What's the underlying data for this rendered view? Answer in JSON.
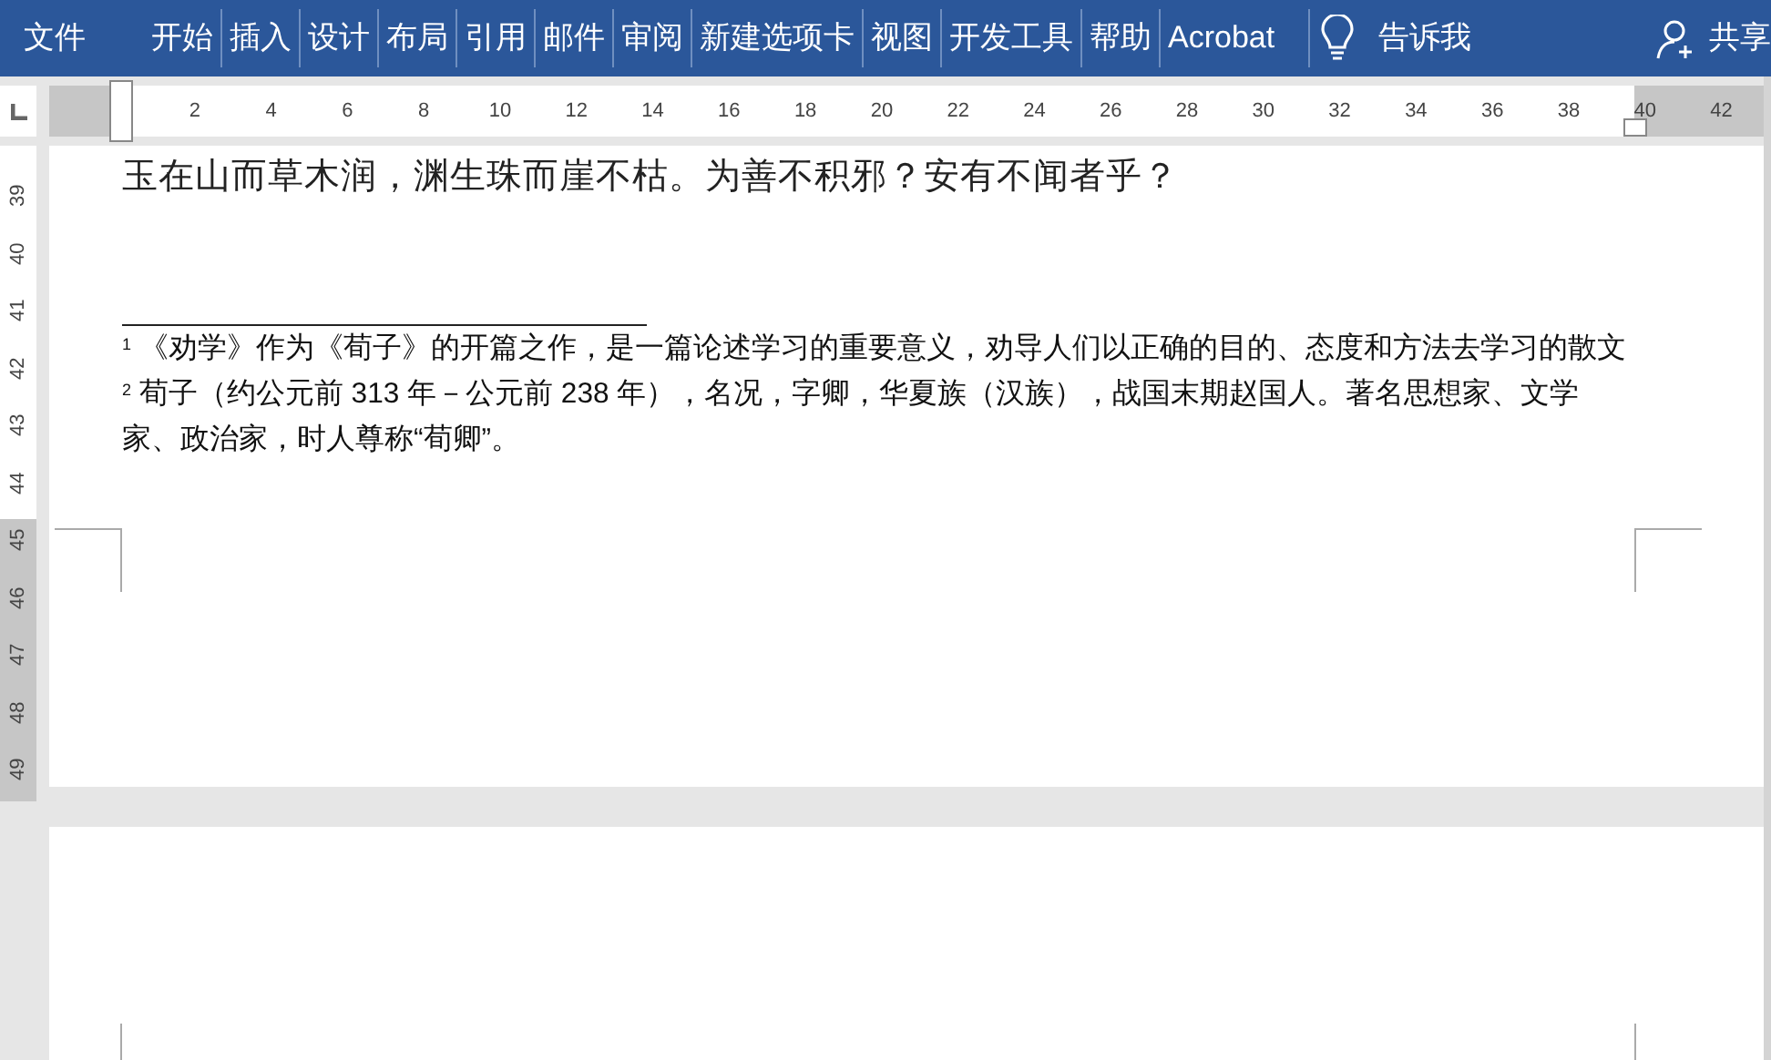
{
  "ribbon": {
    "tabs": [
      {
        "label": "文件",
        "kind": "file"
      },
      {
        "label": "开始",
        "kind": "tab"
      },
      {
        "label": "插入",
        "kind": "tab"
      },
      {
        "label": "设计",
        "kind": "tab"
      },
      {
        "label": "布局",
        "kind": "tab"
      },
      {
        "label": "引用",
        "kind": "tab"
      },
      {
        "label": "邮件",
        "kind": "tab"
      },
      {
        "label": "审阅",
        "kind": "tab"
      },
      {
        "label": "新建选项卡",
        "kind": "tab"
      },
      {
        "label": "视图",
        "kind": "tab"
      },
      {
        "label": "开发工具",
        "kind": "tab"
      },
      {
        "label": "帮助",
        "kind": "tab"
      },
      {
        "label": "Acrobat",
        "kind": "tab"
      }
    ],
    "tell_me": "告诉我",
    "share": "共享"
  },
  "horizontal_ruler": [
    "2",
    "4",
    "6",
    "8",
    "10",
    "12",
    "14",
    "16",
    "18",
    "20",
    "22",
    "24",
    "26",
    "28",
    "30",
    "32",
    "34",
    "36",
    "38",
    "40",
    "42"
  ],
  "vertical_ruler": [
    "39",
    "40",
    "41",
    "42",
    "43",
    "44",
    "45",
    "46",
    "47",
    "48",
    "49"
  ],
  "document": {
    "body": "玉在山而草木润，渊生珠而崖不枯。为善不积邪？安有不闻者乎？",
    "footnotes": [
      "$^{1}$ 《劝学》作为《荀子》的开篇之作，是一篇论述学习的重要意义，劝导人们以正确的目的、态度和方法去学习的散文",
      "$^{2}$ 荀子（约公元前 313 年－公元前 238 年），名况，字卿，华夏族（汉族），战国末期赵国人。著名思想家、文学家、政治家，时人尊称“荀卿”。"
    ]
  }
}
